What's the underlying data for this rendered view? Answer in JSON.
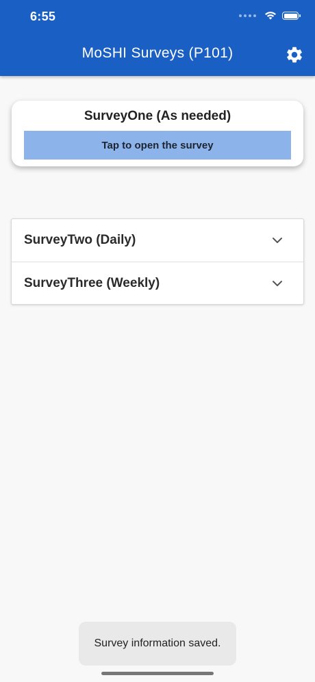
{
  "status_bar": {
    "time": "6:55",
    "icons": [
      "signal-dots-icon",
      "wifi-icon",
      "battery-icon"
    ]
  },
  "header": {
    "title": "MoSHI Surveys (P101)",
    "background_color": "#1a5fc4",
    "settings_icon": "gear-icon"
  },
  "featured_survey": {
    "title": "SurveyOne (As needed)",
    "button_label": "Tap to open the survey",
    "button_color": "#8db4ea"
  },
  "surveys": [
    {
      "label": "SurveyTwo (Daily)",
      "icon": "chevron-down-icon"
    },
    {
      "label": "SurveyThree (Weekly)",
      "icon": "chevron-down-icon"
    }
  ],
  "toast": {
    "message": "Survey information saved."
  }
}
